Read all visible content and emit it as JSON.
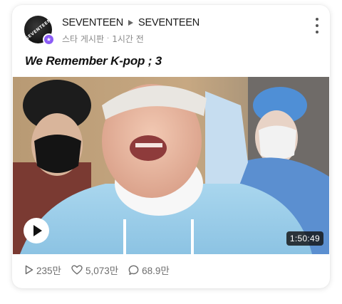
{
  "post": {
    "channel_source": "SEVENTEEN",
    "channel_target": "SEVENTEEN",
    "board": "스타 게시판",
    "time": "1시간 전",
    "title": "We Remember K-pop ; 3",
    "avatar_text": "SEVENTEEN"
  },
  "video": {
    "duration": "1:50:49"
  },
  "stats": {
    "plays": "235만",
    "likes": "5,073만",
    "comments": "68.9만"
  },
  "colors": {
    "badge": "#8b5cf6",
    "meta_text": "#8a8a8a",
    "stat_text": "#6e6e6e"
  },
  "icons": [
    "more-vert-icon",
    "play-triangle-icon",
    "heart-icon",
    "comment-bubble-icon",
    "star-badge-icon",
    "arrow-right-icon"
  ]
}
